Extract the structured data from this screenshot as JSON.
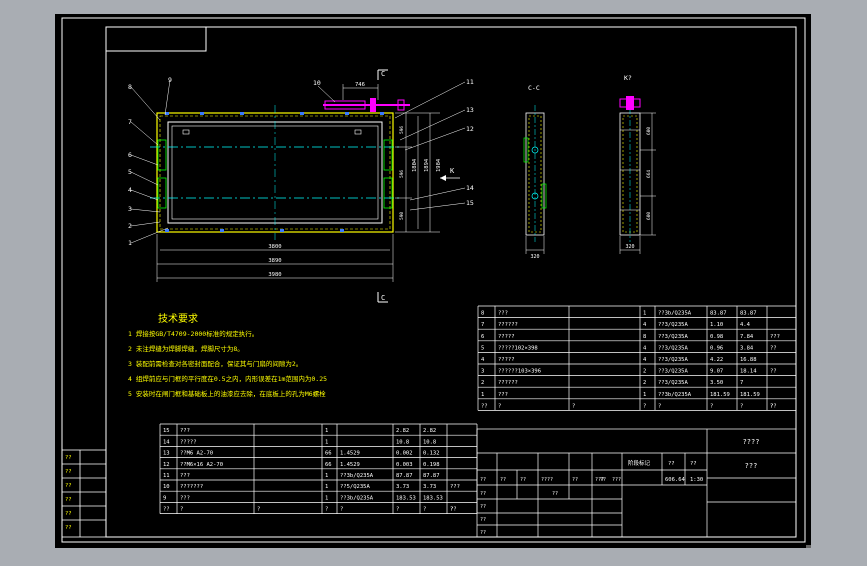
{
  "colors": {
    "background": "#a9adb3",
    "canvas": "#000000",
    "frame": "#ffffff",
    "text": "#ffffff",
    "dim": "#ffffff",
    "yellow": "#ffff00",
    "cyan": "#00ffff",
    "magenta": "#ff00ff",
    "green": "#00ff00",
    "blue": "#3a7bff"
  },
  "views": {
    "section_cc": "C-C",
    "view_k": "K?",
    "cut_c_top": "C",
    "cut_c_bottom": "C",
    "view_arrow_k": "K"
  },
  "balloons": [
    "1",
    "2",
    "3",
    "4",
    "5",
    "6",
    "7",
    "8",
    "9",
    "10",
    "11",
    "12",
    "13",
    "14",
    "15"
  ],
  "dimensions": {
    "top_offset": "746",
    "overall_w1": "3800",
    "overall_w2": "3890",
    "overall_w3": "3980",
    "height_1": "1804",
    "height_2": "1894",
    "height_3": "1984",
    "pitch_top": "596",
    "pitch_mid": "596",
    "pitch_bot": "590",
    "cc_width": "320",
    "k_width": "320",
    "k_seg1": "600",
    "k_seg2": "664",
    "k_seg3": "600"
  },
  "notes": {
    "title": "技术要求",
    "lines": [
      "1 焊接按GB/T4709-2000标准的规定执行。",
      "2 未注焊缝为焊脚焊缝，焊脚尺寸为8。",
      "3 装配前需检查对各密封面配合，保证其与门扇的间隙为2。",
      "4 组焊前应与门框的平行度在0.5之内，内形误差在1m范围内为0.25",
      "5 安装时在闸门框和基础板上的油漆应去除，在底板上的孔为M6螺栓"
    ]
  },
  "bom_top": {
    "rows": [
      {
        "no": "8",
        "code": "???",
        "name": "",
        "qty": "1",
        "mat": "??3b/Q235A",
        "w1": "83.87",
        "w2": "83.87",
        "note": ""
      },
      {
        "no": "7",
        "code": "??????",
        "name": "",
        "qty": "4",
        "mat": "??3/Q235A",
        "w1": "1.10",
        "w2": "4.4",
        "note": ""
      },
      {
        "no": "6",
        "code": "?????",
        "name": "",
        "qty": "8",
        "mat": "??3/Q235A",
        "w1": "0.98",
        "w2": "7.84",
        "note": "???"
      },
      {
        "no": "5",
        "code": "?????102×398",
        "name": "",
        "qty": "4",
        "mat": "??3/Q235A",
        "w1": "0.96",
        "w2": "3.84",
        "note": "??"
      },
      {
        "no": "4",
        "code": "?????",
        "name": "",
        "qty": "4",
        "mat": "??3/Q235A",
        "w1": "4.22",
        "w2": "16.88",
        "note": ""
      },
      {
        "no": "3",
        "code": "??????103×396",
        "name": "",
        "qty": "2",
        "mat": "??3/Q235A",
        "w1": "9.07",
        "w2": "18.14",
        "note": "??"
      },
      {
        "no": "2",
        "code": "??????",
        "name": "",
        "qty": "2",
        "mat": "??3/Q235A",
        "w1": "3.50",
        "w2": "7",
        "note": ""
      },
      {
        "no": "1",
        "code": "???",
        "name": "",
        "qty": "1",
        "mat": "??3b/Q235A",
        "w1": "181.59",
        "w2": "181.59",
        "note": ""
      }
    ],
    "header": [
      "??",
      "?",
      "?",
      "?",
      "?",
      "?",
      "?",
      "?",
      "??"
    ]
  },
  "bom_bottom": {
    "rows": [
      {
        "no": "15",
        "code": "???",
        "name": "",
        "qty": "1",
        "mat": "",
        "w1": "2.82",
        "w2": "2.82",
        "note": ""
      },
      {
        "no": "14",
        "code": "?????",
        "name": "",
        "qty": "1",
        "mat": "",
        "w1": "10.8",
        "w2": "10.8",
        "note": ""
      },
      {
        "no": "13",
        "code": "??M6   A2-70",
        "name": "",
        "qty": "66",
        "mat": "1.4529",
        "w1": "0.002",
        "w2": "0.132",
        "note": ""
      },
      {
        "no": "12",
        "code": "??M6×16 A2-70",
        "name": "",
        "qty": "66",
        "mat": "1.4529",
        "w1": "0.003",
        "w2": "0.198",
        "note": ""
      },
      {
        "no": "11",
        "code": "???",
        "name": "",
        "qty": "1",
        "mat": "??3b/Q235A",
        "w1": "87.87",
        "w2": "87.87",
        "note": ""
      },
      {
        "no": "10",
        "code": "???????",
        "name": "",
        "qty": "1",
        "mat": "??5/Q235A",
        "w1": "3.73",
        "w2": "3.73",
        "note": "???"
      },
      {
        "no": "9",
        "code": "???",
        "name": "",
        "qty": "1",
        "mat": "??3b/Q235A",
        "w1": "183.53",
        "w2": "183.53",
        "note": ""
      }
    ],
    "header": [
      "??",
      "?",
      "?",
      "?",
      "?",
      "?",
      "?",
      "?",
      "??"
    ]
  },
  "title_block": {
    "drawing_name": "????",
    "company": "???",
    "stage_label": "阶段标记",
    "weight_label": "??",
    "scale_label": "??",
    "scale_value": "1:30",
    "weight_value": "606.64",
    "design_row": [
      "??",
      "??",
      "??",
      "????",
      "??",
      "???",
      "??",
      "???"
    ],
    "sign_rows": [
      [
        "??",
        "",
        "",
        "??"
      ],
      [
        "??",
        "",
        "",
        ""
      ],
      [
        "??",
        "",
        "",
        ""
      ],
      [
        "??",
        "",
        "",
        ""
      ]
    ]
  },
  "left_strip": [
    "??",
    "??",
    "??",
    "??",
    "??",
    "??"
  ],
  "top_left_box": ""
}
